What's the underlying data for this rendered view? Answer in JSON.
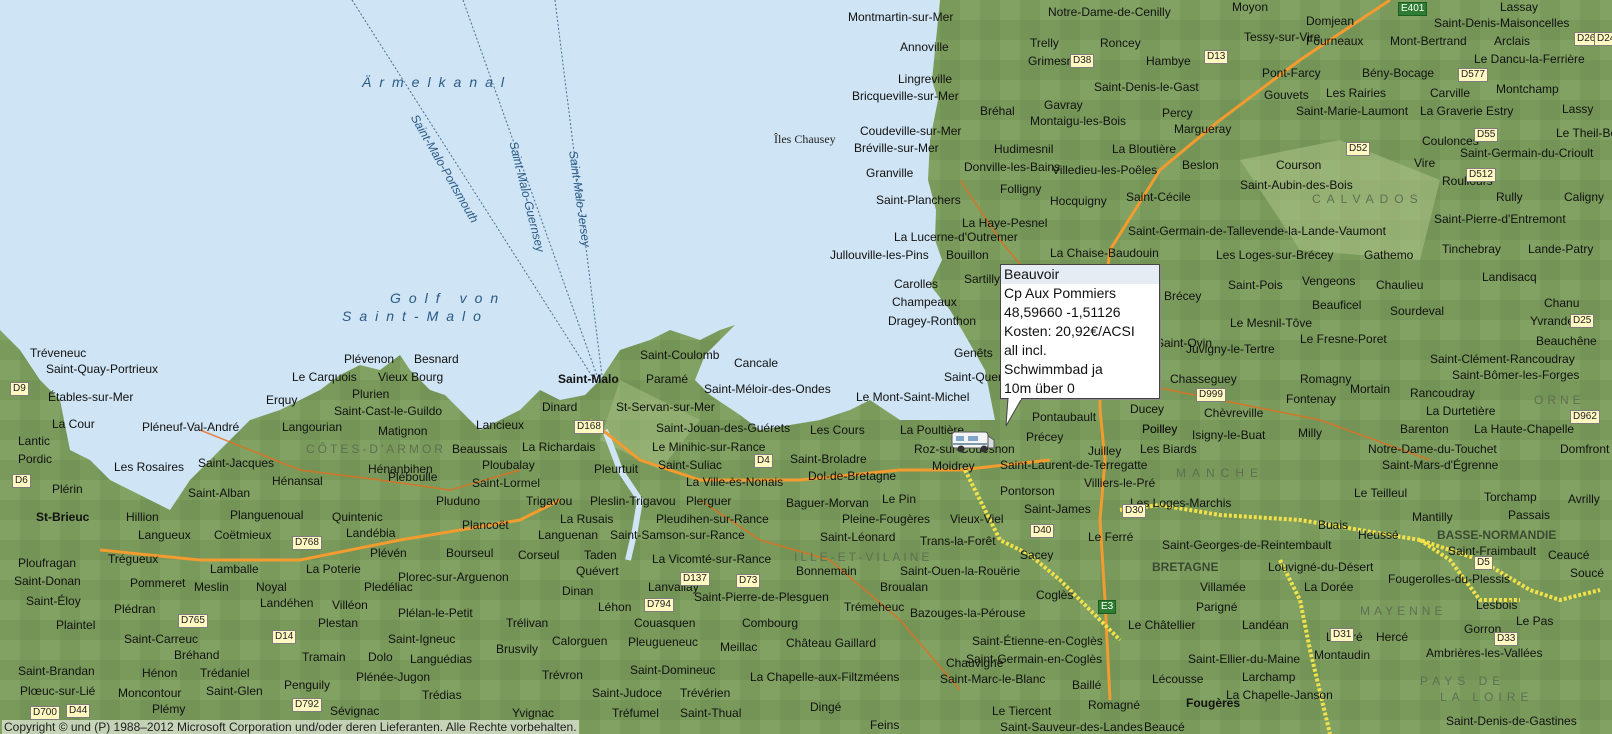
{
  "map": {
    "water_labels": {
      "channel": "Ärmelkanal",
      "gulf_line1": "Golf von",
      "gulf_line2": "Saint-Malo"
    },
    "ferry_routes": [
      "Saint-Malo-Portsmouth",
      "Saint-Malo-Guernsey",
      "Saint-Malo-Jersey"
    ],
    "island_label": "Îles Chausey",
    "regions": [
      "CÔTES-D'ARMOR",
      "ILLE-ET-VILAINE",
      "MANCHE",
      "CALVADOS",
      "ORNE",
      "MAYENNE",
      "PAYS DE",
      "LA LOIRE",
      "BRETAGNE",
      "BASSE-NORMANDIE"
    ],
    "places": [
      "Montmartin-sur-Mer",
      "Annoville",
      "Lingreville",
      "Bricqueville-sur-Mer",
      "Coudeville-sur-Mer",
      "Bréville-sur-Mer",
      "Granville",
      "Saint-Planchers",
      "La Lucerne-d'Outremer",
      "Jullouville-les-Pins",
      "Carolles",
      "Champeaux",
      "Dragey-Ronthon",
      "Genêts",
      "Saint-Quentin",
      "Le Mont-Saint-Michel",
      "La Poultière",
      "Roz-sur-Couesnon",
      "Moidrey",
      "Pontorson",
      "Saint-Broladre",
      "Dol-de-Bretagne",
      "Cancale",
      "Saint-Coulomb",
      "Paramé",
      "Saint-Malo",
      "Saint-Méloir-des-Ondes",
      "Dinard",
      "St-Servan-sur-Mer",
      "Saint-Jouan-des-Guérets",
      "Les Cours",
      "Le Minihic-sur-Rance",
      "La Richardais",
      "Saint-Suliac",
      "La Ville-ès-Nonais",
      "Pleurtuit",
      "Lancieux",
      "Beaussais",
      "Ploubalay",
      "Saint-Lormel",
      "Trigavou",
      "Pleslin-Trigavou",
      "Plerguer",
      "Baguer-Morvan",
      "Le Pin",
      "Pleine-Fougères",
      "Vieux-Viel",
      "La Rusais",
      "Pleudihen-sur-Rance",
      "Saint-Léonard",
      "Trans-la-Forêt",
      "Languenan",
      "Saint-Samson-sur-Rance",
      "Bonnemain",
      "Saint-Ouen-la-Rouërie",
      "Corseul",
      "Taden",
      "Quévert",
      "Dinan",
      "Lanvallay",
      "La Vicomté-sur-Rance",
      "Saint-Pierre-de-Plesguen",
      "Broualan",
      "Trémeheuc",
      "Bazouges-la-Pérouse",
      "Léhon",
      "Combourg",
      "Couasquen",
      "Pleugueneuc",
      "Meillac",
      "Château Gaillard",
      "Calorguen",
      "Trélivan",
      "Brusvily",
      "Trévron",
      "Saint-Domineuc",
      "Saint-Judoce",
      "Trévérien",
      "Tréfumel",
      "Saint-Thual",
      "Yvignac",
      "La Chapelle-aux-Filtzméens",
      "Dingé",
      "Feins",
      "Plévenon",
      "Besnard",
      "Le Carquois",
      "Vieux Bourg",
      "Plurien",
      "Erquy",
      "Saint-Cast-le-Guildo",
      "Matignon",
      "Langourian",
      "Pléneuf-Val-André",
      "Saint-Quay-Portrieux",
      "Tréveneuc",
      "Étables-sur-Mer",
      "La Cour",
      "Lantic",
      "Pordic",
      "Les Rosaires",
      "Saint-Jacques",
      "Hénansal",
      "Hénanbihen",
      "Saint-Alban",
      "Plérin",
      "St-Brieuc",
      "Hillion",
      "Langueux",
      "Planguenoual",
      "Quintenic",
      "Coëtmieux",
      "Landébia",
      "Pluduno",
      "Plancoët",
      "Bourseul",
      "Plévén",
      "Plorec-sur-Arguenon",
      "Pléboulle",
      "Trégueux",
      "Ploufragan",
      "Saint-Donan",
      "Saint-Éloy",
      "Plaintel",
      "Pommeret",
      "Meslin",
      "Lamballe",
      "Noyal",
      "La Poterie",
      "Pledéliac",
      "Villéon",
      "Landéhen",
      "Plestan",
      "Plédran",
      "Saint-Carreuc",
      "Bréhand",
      "Plélan-le-Petit",
      "Saint-Igneuc",
      "Tramain",
      "Dolo",
      "Languédias",
      "Plénée-Jugon",
      "Trédias",
      "Penguily",
      "Saint-Glen",
      "Trédaniel",
      "Hénon",
      "Moncontour",
      "Plémy",
      "Saint-Brandan",
      "Plœuc-sur-Lié",
      "Sévignac",
      "Notre-Dame-de-Cenilly",
      "Moyon",
      "Trelly",
      "Roncey",
      "Grimesnil",
      "Hambye",
      "Tessy-sur-Vire",
      "Saint-Denis-le-Gast",
      "Bréhal",
      "Gavray",
      "Montaigu-les-Bois",
      "Percy",
      "Margueray",
      "La Bloutière",
      "Hudimesnil",
      "Donville-les-Bains",
      "Villedieu-les-Poêles",
      "Folligny",
      "Hocquigny",
      "Saint-Cécile",
      "Beslon",
      "La Haye-Pesnel",
      "Bouillon",
      "La Chaise-Baudouin",
      "Sartilly",
      "Saint-Pois",
      "Brécey",
      "Saint-Ovin",
      "Juvigny-le-Tertre",
      "Le Mesnil-Tôve",
      "Les Loges-sur-Brécey",
      "Saint-Germain-de-Tallevende-la-Lande-Vaumont",
      "Ducey",
      "Poilley",
      "Juilley",
      "Les Biards",
      "Précey",
      "Pontaubault",
      "Chasseguey",
      "Chèvreville",
      "Isigny-le-Buat",
      "Saint-Laurent-de-Terregatte",
      "Villiers-le-Pré",
      "Saint-James",
      "Le Ferré",
      "Sacey",
      "Poilley",
      "Coglès",
      "Le Châtellier",
      "Parigné",
      "Saint-Étienne-en-Coglès",
      "Saint-Germain-en-Coglès",
      "Saint-Marc-le-Blanc",
      "Chauvigné",
      "Le Tiercent",
      "Saint-Sauveur-des-Landes",
      "Romagné",
      "Fougères",
      "Beaucé",
      "Baillé",
      "Lécousse",
      "Saint-Ellier-du-Maine",
      "Montaudin",
      "Landéan",
      "Villamée",
      "Louvigné-du-Désert",
      "La Dorée",
      "Saint-Georges-de-Reintembault",
      "Les Loges-Marchis",
      "Buais",
      "Heussé",
      "Mantilly",
      "Le Teilleul",
      "Fougerolles-du-Plessis",
      "Lesbois",
      "Gorron",
      "Levaré",
      "Hercé",
      "Ambrières-les-Vallées",
      "Le Pas",
      "Lassay",
      "Saint-Fraimbault",
      "Saint-Denis-de-Gastines",
      "Larchamp",
      "La Chapelle-Janson",
      "Domjean",
      "Saint-Denis-Maisoncelles",
      "Fourneaux",
      "Mont-Bertrand",
      "Arclais",
      "Le Dancu-la-Ferrière",
      "Pont-Farcy",
      "Bény-Bocage",
      "Montchamp",
      "Gouvets",
      "Carville",
      "Les Rairies",
      "Saint-Marie-Laumont",
      "La Graverie",
      "Estry",
      "Lassy",
      "Le Theil-Bocage",
      "Coulonces",
      "Saint-Germain-du-Crioult",
      "Vire",
      "Courson",
      "Saint-Aubin-des-Bois",
      "Roullours",
      "Rully",
      "Caligny",
      "Saint-Pierre-d'Entremont",
      "Tinchebray",
      "Lande-Patry",
      "Gathemo",
      "Vengeons",
      "Chaulieu",
      "Landisacq",
      "Beauficel",
      "Chanu",
      "Sourdeval",
      "Yvrandes",
      "Le Fresne-Poret",
      "Beauchêne",
      "Saint-Clément-Rancoudray",
      "Saint-Bômer-les-Forges",
      "Mortain",
      "Rancoudray",
      "Romagny",
      "Fontenay",
      "La Durtetière",
      "Barenton",
      "La Haute-Chapelle",
      "Milly",
      "Domfront",
      "Notre-Dame-du-Touchet",
      "Saint-Mars-d'Égrenne",
      "Torchamp",
      "Passais",
      "Avrilly",
      "Saint-Symphorien",
      "Ceaucé",
      "Soucé",
      "Saint-Pair",
      "Le Neufbourg",
      "Saint-Hilaire-du-Harcouët",
      "Virey",
      "Parigny",
      "Lapenty",
      "Saint-Martin-de-Landelles",
      "Landelles-et-Coupigny"
    ],
    "road_shields": [
      "E401",
      "D26",
      "D24",
      "D577",
      "D38",
      "D13",
      "D55",
      "D52",
      "D512",
      "D25",
      "D962",
      "D999",
      "D9",
      "D6",
      "D168",
      "D768",
      "D4",
      "D137",
      "D73",
      "D794",
      "D765",
      "D14",
      "D40",
      "D30",
      "D5",
      "D31",
      "D33",
      "D792",
      "D700",
      "D44",
      "E3"
    ],
    "popup": {
      "lines": [
        "Beauvoir",
        "Cp Aux Pommiers",
        "48,59660 -1,51126",
        "Kosten: 20,92€/ACSI",
        "all incl.",
        "Schwimmbad ja",
        "10m über 0"
      ]
    },
    "marker_icon": "camper-van-icon",
    "copyright": "Copyright © und (P) 1988–2012 Microsoft Corporation und/oder deren Lieferanten. Alle Rechte vorbehalten.",
    "colors": {
      "sea": "#cfe4f4",
      "land": "#7a9a5c",
      "land_light": "#9bb47a",
      "motorway": "#f29b2f",
      "border": "#f2e14a"
    }
  }
}
